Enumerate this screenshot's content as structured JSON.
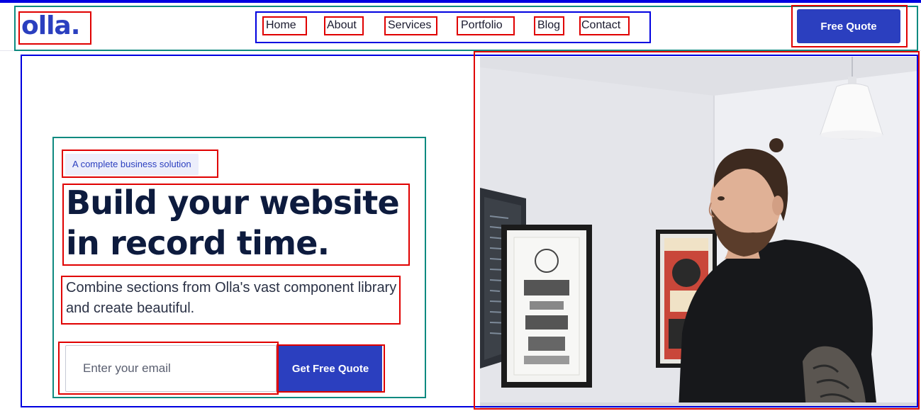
{
  "brand": {
    "logo": "olla."
  },
  "nav": {
    "items": [
      "Home",
      "About",
      "Services",
      "Portfolio",
      "Blog",
      "Contact"
    ]
  },
  "header": {
    "cta_label": "Free Quote"
  },
  "hero": {
    "badge": "A complete business solution",
    "headline": "Build your website in record time.",
    "subtext": "Combine sections from Olla's vast component library and create beautiful.",
    "email_placeholder": "Enter your email",
    "cta_label": "Get Free Quote"
  },
  "colors": {
    "brand_blue": "#2b3fbf",
    "annotation_red": "#e00000",
    "annotation_blue": "#0000e0",
    "annotation_teal": "#0e8a80"
  }
}
